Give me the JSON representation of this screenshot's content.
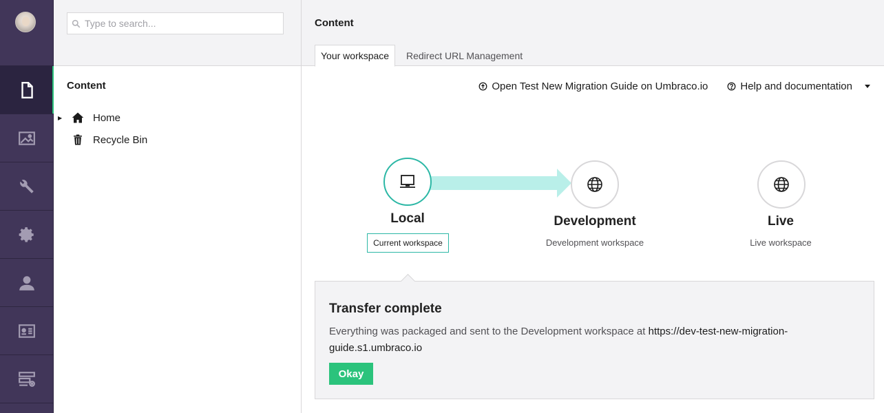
{
  "nav": {
    "items": [
      {
        "icon": "document-icon",
        "name": "content",
        "active": true
      },
      {
        "icon": "image-icon",
        "name": "media",
        "active": false
      },
      {
        "icon": "wrench-icon",
        "name": "settings-tools",
        "active": false
      },
      {
        "icon": "gear-icon",
        "name": "settings",
        "active": false
      },
      {
        "icon": "user-icon",
        "name": "users",
        "active": false
      },
      {
        "icon": "contact-card-icon",
        "name": "members",
        "active": false
      },
      {
        "icon": "forms-icon",
        "name": "forms",
        "active": false
      }
    ]
  },
  "tree": {
    "search_placeholder": "Type to search...",
    "title": "Content",
    "nodes": [
      {
        "label": "Home",
        "icon": "home-icon",
        "has_children": true
      },
      {
        "label": "Recycle Bin",
        "icon": "trash-icon",
        "has_children": false
      }
    ]
  },
  "main": {
    "title": "Content",
    "tabs": [
      {
        "label": "Your workspace",
        "active": true
      },
      {
        "label": "Redirect URL Management",
        "active": false
      }
    ],
    "links": {
      "guide": "Open Test New Migration Guide on Umbraco.io",
      "help": "Help and documentation"
    }
  },
  "workflow": {
    "local": {
      "label": "Local",
      "badge": "Current workspace",
      "icon": "laptop-icon"
    },
    "development": {
      "label": "Development",
      "sub": "Development workspace",
      "icon": "globe-icon"
    },
    "live": {
      "label": "Live",
      "sub": "Live workspace",
      "icon": "globe-icon"
    }
  },
  "transfer": {
    "title": "Transfer complete",
    "text": "Everything was packaged and sent to the Development workspace at ",
    "url": "https://dev-test-new-migration-guide.s1.umbraco.io",
    "button": "Okay"
  },
  "colors": {
    "rail": "#413659",
    "accent_teal": "#2bb7a5",
    "arrow": "#b9efe9",
    "success": "#2bc37c"
  }
}
